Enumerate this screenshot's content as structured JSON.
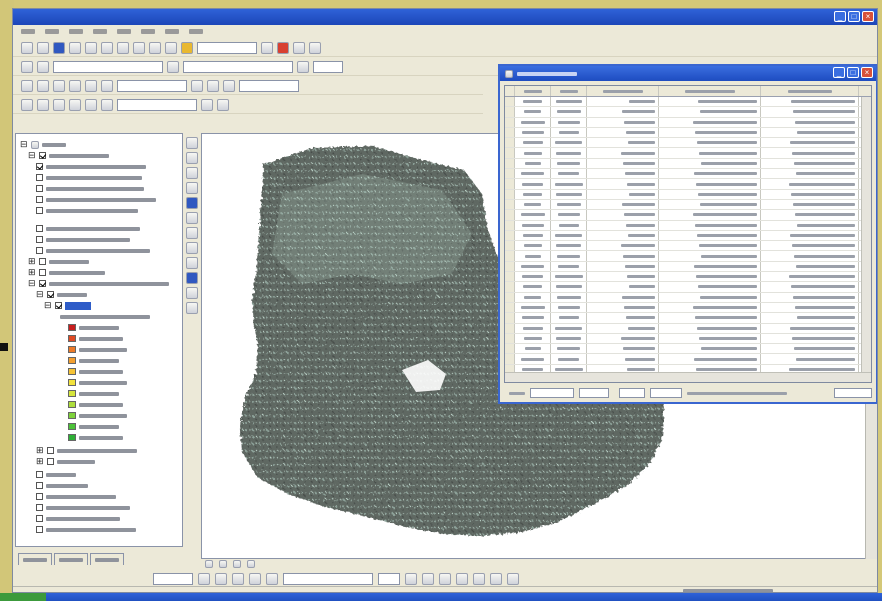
{
  "window": {
    "title": "",
    "controls": [
      "_",
      "□",
      "×"
    ]
  },
  "colors": {
    "slide_background": "#d4c878",
    "titlebar": "#2f62d8",
    "selection": "#2e5cc8",
    "map_fill": "#5f6762",
    "map_highlight": "#9fb8ae"
  },
  "toc": {
    "tabs": [
      "",
      "",
      ""
    ],
    "legend_colors": [
      "#c81e1e",
      "#e04a24",
      "#ec7a28",
      "#f4a030",
      "#f6c436",
      "#f2e23c",
      "#d6e63c",
      "#aede3c",
      "#7ed23a",
      "#4cc238",
      "#2eb036"
    ]
  },
  "attribute_window": {
    "title": "",
    "controls": [
      "_",
      "□",
      "×"
    ],
    "columns": [
      "",
      "",
      "",
      "",
      ""
    ],
    "row_count": 28,
    "footer": {
      "record_label": "",
      "show_label": "",
      "all_button": "",
      "selected_button": "",
      "options_button": ""
    }
  }
}
